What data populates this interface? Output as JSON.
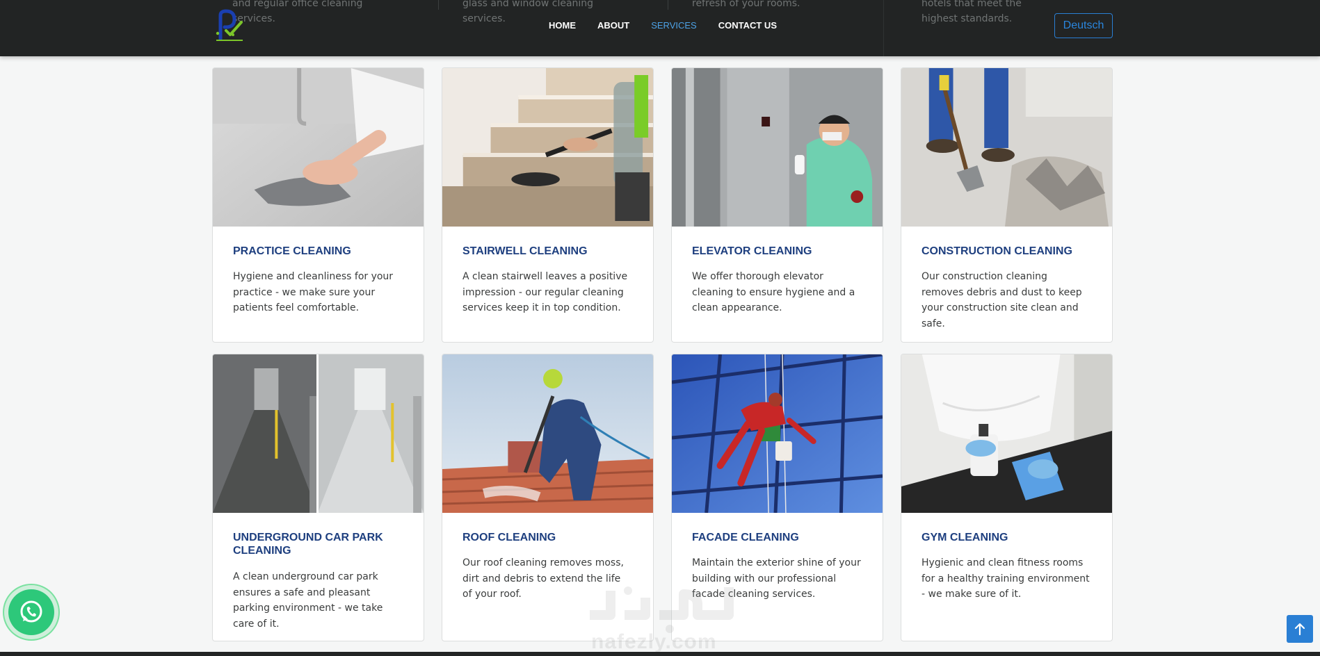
{
  "header": {
    "nav": [
      {
        "label": "HOME",
        "active": false
      },
      {
        "label": "ABOUT",
        "active": false
      },
      {
        "label": "SERVICES",
        "active": true
      },
      {
        "label": "CONTACT US",
        "active": false
      }
    ],
    "language_button": "Deutsch",
    "behind_text": [
      "and regular office cleaning services.",
      "glass and window cleaning services.",
      "refresh of your rooms.",
      "hotels that meet the highest standards."
    ]
  },
  "services": [
    {
      "title": "PRACTICE CLEANING",
      "text": "Hygiene and cleanliness for your practice - we make sure your patients feel comfortable."
    },
    {
      "title": "STAIRWELL CLEANING",
      "text": "A clean stairwell leaves a positive impression - our regular cleaning services keep it in top condition."
    },
    {
      "title": "ELEVATOR CLEANING",
      "text": "We offer thorough elevator cleaning to ensure hygiene and a clean appearance."
    },
    {
      "title": "CONSTRUCTION CLEANING",
      "text": "Our construction cleaning removes debris and dust to keep your construction site clean and safe."
    },
    {
      "title": "UNDERGROUND CAR PARK CLEANING",
      "text": "A clean underground car park ensures a safe and pleasant parking environment - we take care of it."
    },
    {
      "title": "ROOF CLEANING",
      "text": "Our roof cleaning removes moss, dirt and debris to extend the life of your roof."
    },
    {
      "title": "FACADE CLEANING",
      "text": "Maintain the exterior shine of your building with our professional facade cleaning services."
    },
    {
      "title": "GYM CLEANING",
      "text": "Hygienic and clean fitness rooms for a healthy training environment - we make sure of it."
    }
  ],
  "watermark": {
    "latin": "nafezly.com"
  },
  "colors": {
    "navbar_bg": "#222424",
    "accent": "#2a7fd4",
    "nav_active": "#4da2e6",
    "title": "#1e3f7f",
    "whatsapp": "#2dc87a"
  },
  "icons": {
    "logo": "company-logo",
    "whatsapp": "whatsapp-icon",
    "scroll_top": "arrow-up-icon"
  }
}
